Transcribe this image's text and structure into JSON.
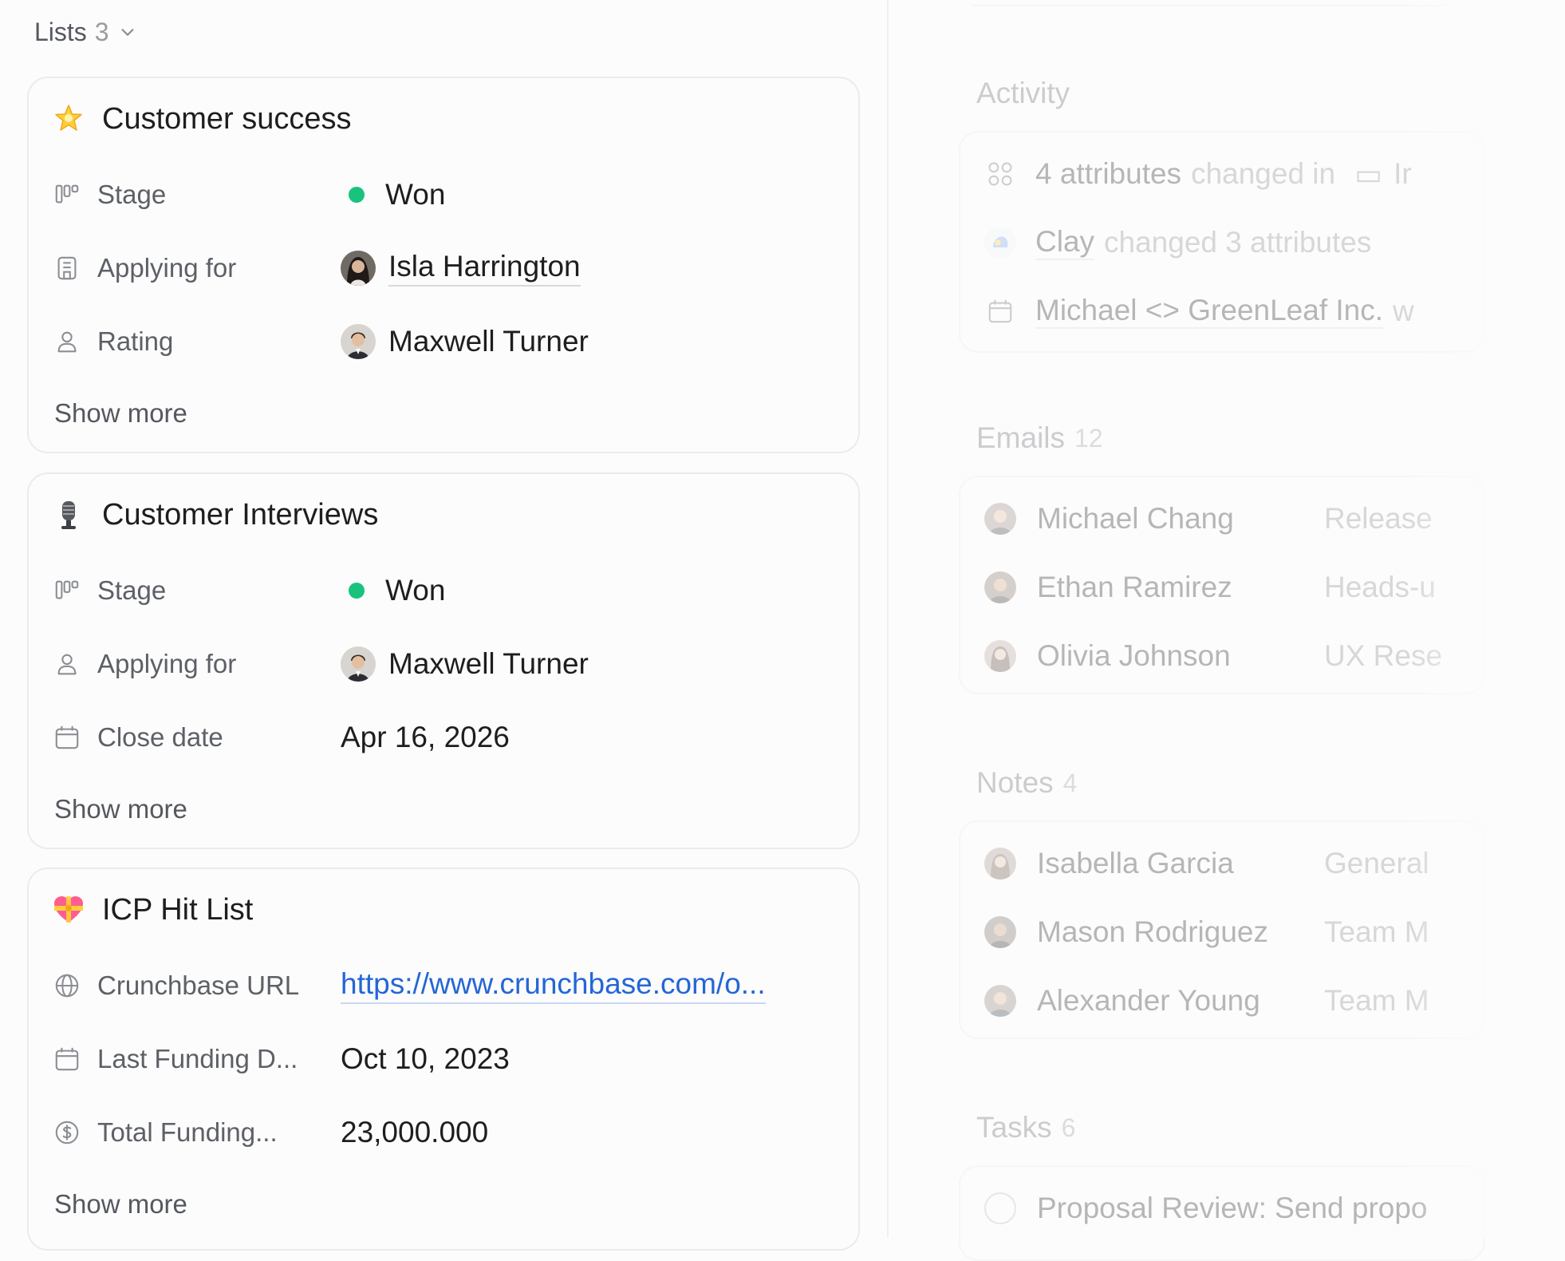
{
  "lists": {
    "label": "Lists",
    "count": "3"
  },
  "cards": [
    {
      "title": "Customer success",
      "emoji": "star-emoji",
      "rows": [
        {
          "icon": "stage-icon",
          "label": "Stage",
          "value": "Won",
          "kind": "status",
          "status_color": "#19c37d"
        },
        {
          "icon": "building-icon",
          "label": "Applying for",
          "value": "Isla Harrington",
          "kind": "person",
          "underline": true
        },
        {
          "icon": "user-icon",
          "label": "Rating",
          "value": "Maxwell Turner",
          "kind": "person"
        }
      ],
      "show_more": "Show more"
    },
    {
      "title": "Customer Interviews",
      "emoji": "microphone-emoji",
      "rows": [
        {
          "icon": "stage-icon",
          "label": "Stage",
          "value": "Won",
          "kind": "status",
          "status_color": "#19c37d"
        },
        {
          "icon": "user-icon",
          "label": "Applying for",
          "value": "Maxwell Turner",
          "kind": "person"
        },
        {
          "icon": "calendar-icon",
          "label": "Close date",
          "value": "Apr 16, 2026",
          "kind": "text"
        }
      ],
      "show_more": "Show more"
    },
    {
      "title": "ICP Hit List",
      "emoji": "heart-ribbon-emoji",
      "rows": [
        {
          "icon": "globe-icon",
          "label": "Crunchbase URL",
          "value": "https://www.crunchbase.com/o...",
          "kind": "link"
        },
        {
          "icon": "calendar-icon",
          "label": "Last Funding D...",
          "value": "Oct 10, 2023",
          "kind": "text"
        },
        {
          "icon": "dollar-icon",
          "label": "Total Funding...",
          "value": "23,000.000",
          "kind": "text"
        }
      ],
      "show_more": "Show more"
    }
  ],
  "activity": {
    "title": "Activity",
    "items": [
      {
        "icon": "attributes-icon",
        "text": "4 attributes",
        "rest": "changed in",
        "tail": "Ir"
      },
      {
        "icon": "clay-icon",
        "text": "Clay",
        "rest": "changed 3 attributes"
      },
      {
        "icon": "calendar-icon",
        "text": "Michael <> GreenLeaf Inc.",
        "rest": "w"
      }
    ]
  },
  "emails": {
    "title": "Emails",
    "count": "12",
    "items": [
      {
        "name": "Michael Chang",
        "subject": "Release"
      },
      {
        "name": "Ethan Ramirez",
        "subject": "Heads-u"
      },
      {
        "name": "Olivia Johnson",
        "subject": "UX Rese"
      }
    ]
  },
  "notes": {
    "title": "Notes",
    "count": "4",
    "items": [
      {
        "name": "Isabella Garcia",
        "subject": "General"
      },
      {
        "name": "Mason Rodriguez",
        "subject": "Team M"
      },
      {
        "name": "Alexander Young",
        "subject": "Team M"
      }
    ]
  },
  "tasks": {
    "title": "Tasks",
    "count": "6",
    "items": [
      {
        "text": "Proposal Review: Send propo"
      }
    ]
  }
}
